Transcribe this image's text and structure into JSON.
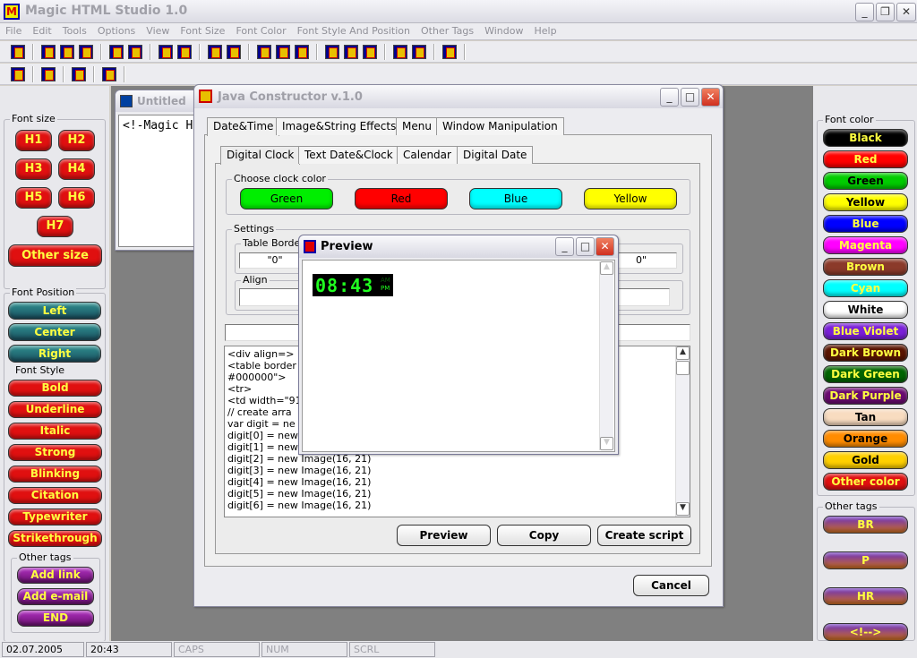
{
  "app": {
    "title": "Magic HTML Studio 1.0",
    "icon": "M"
  },
  "menu": [
    "File",
    "Edit",
    "Tools",
    "Options",
    "View",
    "Font Size",
    "Font Color",
    "Font Style And Position",
    "Other Tags",
    "Window",
    "Help"
  ],
  "left": {
    "font_size_title": "Font size",
    "sizes": [
      "H1",
      "H2",
      "H3",
      "H4",
      "H5",
      "H6"
    ],
    "h7": "H7",
    "other_size": "Other size",
    "font_position_title": "Font Position",
    "positions": [
      "Left",
      "Center",
      "Right"
    ],
    "font_style_title": "Font Style",
    "styles": [
      "Bold",
      "Underline",
      "Italic",
      "Strong",
      "Blinking",
      "Citation",
      "Typewriter",
      "Strikethrough"
    ],
    "other_tags_title": "Other tags",
    "tags": [
      "Add link",
      "Add e-mail",
      "END"
    ]
  },
  "right": {
    "font_color_title": "Font color",
    "colors": [
      {
        "label": "Black",
        "bg": "#000000",
        "fg": "#ffff40"
      },
      {
        "label": "Red",
        "bg": "#ff0000",
        "fg": "#ffff40"
      },
      {
        "label": "Green",
        "bg": "#00cc00",
        "fg": "#000000"
      },
      {
        "label": "Yellow",
        "bg": "#ffff00",
        "fg": "#000000"
      },
      {
        "label": "Blue",
        "bg": "#0000ff",
        "fg": "#ffff40"
      },
      {
        "label": "Magenta",
        "bg": "#ff00ff",
        "fg": "#ffff40"
      },
      {
        "label": "Brown",
        "bg": "#8b3a2a",
        "fg": "#ffff40"
      },
      {
        "label": "Cyan",
        "bg": "#00ffff",
        "fg": "#ffff40"
      },
      {
        "label": "White",
        "bg": "#ffffff",
        "fg": "#000000"
      },
      {
        "label": "Blue Violet",
        "bg": "#7a20d8",
        "fg": "#ffff40"
      },
      {
        "label": "Dark Brown",
        "bg": "#5a1400",
        "fg": "#ffff40"
      },
      {
        "label": "Dark Green",
        "bg": "#006400",
        "fg": "#ffff40"
      },
      {
        "label": "Dark Purple",
        "bg": "#6a0a70",
        "fg": "#ffff40"
      },
      {
        "label": "Tan",
        "bg": "#f8dcc0",
        "fg": "#000000"
      },
      {
        "label": "Orange",
        "bg": "#ff8c00",
        "fg": "#000000"
      },
      {
        "label": "Gold",
        "bg": "#ffd000",
        "fg": "#000000"
      },
      {
        "label": "Other color",
        "bg": "#e01010",
        "fg": "#ffff40"
      }
    ],
    "other_tags_title": "Other tags",
    "tags": [
      "BR",
      "P",
      "HR",
      "<!-->"
    ]
  },
  "untitled": {
    "title": "Untitled",
    "content": "<!-Magic H"
  },
  "java": {
    "title": "Java Constructor v.1.0",
    "tabs": [
      "Date&Time",
      "Image&String Effects",
      "Menu",
      "Window Manipulation"
    ],
    "subtabs": [
      "Digital Clock",
      "Text Date&Clock",
      "Calendar",
      "Digital Date"
    ],
    "clock_color_title": "Choose clock color",
    "clock_colors": [
      {
        "label": "Green",
        "bg": "#00ee00"
      },
      {
        "label": "Red",
        "bg": "#ff0000"
      },
      {
        "label": "Blue",
        "bg": "#00ffff"
      },
      {
        "label": "Yellow",
        "bg": "#ffff00"
      }
    ],
    "settings_title": "Settings",
    "table_border_label": "Table Borde",
    "table_border_value": "\"0\"",
    "right_value": "0\"",
    "align_label": "Align",
    "code": "<div align=>\n<table border                                                            gcolor=\"\n#000000\">\n<tr>\n<td width=\"91\n// create arra\nvar digit = ne\ndigit[0] = new\ndigit[1] = new\ndigit[2] = new Image(16, 21)\ndigit[3] = new Image(16, 21)\ndigit[4] = new Image(16, 21)\ndigit[5] = new Image(16, 21)\ndigit[6] = new Image(16, 21)",
    "buttons": {
      "preview": "Preview",
      "copy": "Copy",
      "create": "Create script",
      "cancel": "Cancel"
    }
  },
  "preview": {
    "title": "Preview",
    "time": "08:43",
    "am": "AM",
    "pm": "PM"
  },
  "status": [
    "02.07.2005",
    "20:43",
    "CAPS",
    "NUM",
    "SCRL"
  ]
}
